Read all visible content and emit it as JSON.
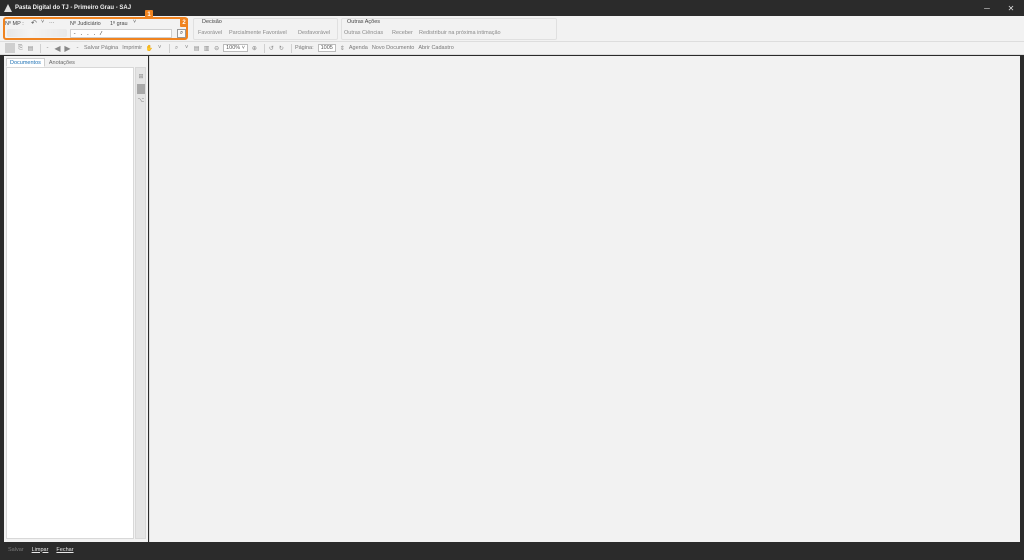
{
  "window": {
    "title": "Pasta Digital do TJ - Primeiro Grau - SAJ",
    "minimize": "─",
    "close": "✕"
  },
  "toolbar1": {
    "nmp_label": "Nº MP :",
    "undo_icon": "↶",
    "dropdown_icon": "˅",
    "more_label": "···",
    "njudiciario_label": "Nº Judiciário",
    "grau_label": "1º grau",
    "grau_dropdown": "˅",
    "process_number_value": "-  .    .    .    /",
    "search_icon": "⌕",
    "badge1": "1",
    "badge2": "2",
    "decisao": {
      "title": "Decisão",
      "items": [
        "Favorável",
        "Parcialmente Favorável",
        "Desfavorável"
      ]
    },
    "outras": {
      "title": "Outras Ações",
      "items": [
        "Outras Ciências",
        "Receber",
        "Redistribuir na próxima intimação"
      ]
    }
  },
  "toolbar2": {
    "save_page": "Salvar Página",
    "print": "Imprimir",
    "zoom_value": "100%",
    "page_label": "Página:",
    "page_value": "1005",
    "agenda": "Agenda",
    "new_document": "Novo Documento",
    "open_registry": "Abrir Cadastro"
  },
  "left_panel": {
    "tabs": [
      "Documentos",
      "Anotações"
    ],
    "active_tab": 0
  },
  "footer": {
    "save": "Salvar",
    "clear": "Limpar",
    "close": "Fechar"
  },
  "colors": {
    "accent_orange": "#f0831f",
    "titlebar": "#2b2b2b",
    "tab_active": "#1a6fb3"
  }
}
